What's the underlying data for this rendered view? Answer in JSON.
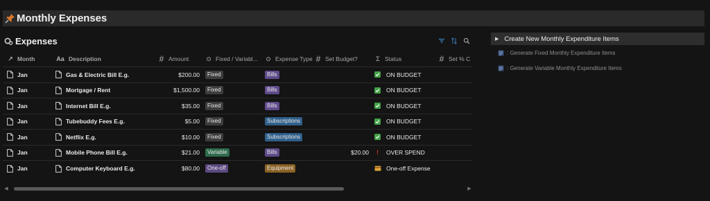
{
  "page": {
    "title": "Monthly Expenses"
  },
  "database": {
    "title": "Expenses",
    "columns": {
      "month": "Month",
      "description": "Description",
      "amount": "Amount",
      "fixed": "Fixed / Variabl...",
      "type": "Expense Type",
      "budget": "Set Budget?",
      "status": "Status",
      "pct": "Set % C"
    },
    "rows": [
      {
        "month": "Jan",
        "description": "Gas & Electric Bill E.g.",
        "amount": "$200.00",
        "fixed": "Fixed",
        "type": "Bills",
        "budget": "",
        "status": "ON BUDGET"
      },
      {
        "month": "Jan",
        "description": "Mortgage / Rent",
        "amount": "$1,500.00",
        "fixed": "Fixed",
        "type": "Bills",
        "budget": "",
        "status": "ON BUDGET"
      },
      {
        "month": "Jan",
        "description": "Internet Bill E.g.",
        "amount": "$35.00",
        "fixed": "Fixed",
        "type": "Bills",
        "budget": "",
        "status": "ON BUDGET"
      },
      {
        "month": "Jan",
        "description": "Tubebuddy Fees E.g.",
        "amount": "$5.00",
        "fixed": "Fixed",
        "type": "Subscriptions",
        "budget": "",
        "status": "ON BUDGET"
      },
      {
        "month": "Jan",
        "description": "Netflix E.g.",
        "amount": "$10.00",
        "fixed": "Fixed",
        "type": "Subscriptions",
        "budget": "",
        "status": "ON BUDGET"
      },
      {
        "month": "Jan",
        "description": "Mobile Phone Bill E.g.",
        "amount": "$21.00",
        "fixed": "Variable",
        "type": "Bills",
        "budget": "$20.00",
        "status": "OVER SPEND"
      },
      {
        "month": "Jan",
        "description": "Computer Keyboard E.g.",
        "amount": "$80.00",
        "fixed": "One-off",
        "type": "Equipment",
        "budget": "",
        "status": "One-off Expense"
      }
    ]
  },
  "sidebar": {
    "toggle_label": "Create New Monthly Expenditure Items",
    "items": [
      {
        "label": ": Generate Fixed Monthly Expenditure Items"
      },
      {
        "label": ": Generate Variable Monthly Expenditure Items"
      }
    ]
  },
  "colors": {
    "fixed": "#3d3d3d",
    "variable": "#2e6b4c",
    "one_off": "#5c4a82",
    "bills": "#5f4b8b",
    "subscriptions": "#2f5f8a",
    "equipment": "#8a6224",
    "status_ok": "#43a047",
    "status_over": "#c0392b"
  }
}
